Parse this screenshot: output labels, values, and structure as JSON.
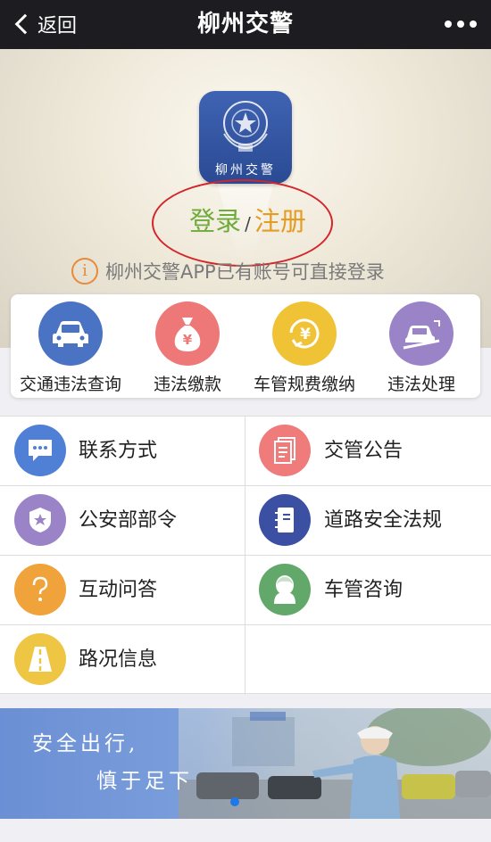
{
  "nav": {
    "back_label": "返回",
    "title": "柳州交警"
  },
  "hero": {
    "logo_text": "柳州交警",
    "login_label": "登录",
    "slash": "/",
    "register_label": "注册",
    "notice_icon_char": "i",
    "notice_text": "柳州交警APP已有账号可直接登录"
  },
  "services": [
    {
      "label": "交通违法查询",
      "icon": "car-icon",
      "color": "#4a74c3"
    },
    {
      "label": "违法缴款",
      "icon": "money-bag-icon",
      "color": "#ee7878"
    },
    {
      "label": "车管规费缴纳",
      "icon": "yen-refresh-icon",
      "color": "#f0c235"
    },
    {
      "label": "违法处理",
      "icon": "car-slope-icon",
      "color": "#9b83c7"
    }
  ],
  "menu": [
    {
      "label": "联系方式",
      "icon": "chat-bubble-icon",
      "color": "#4f80d6"
    },
    {
      "label": "交管公告",
      "icon": "document-icon",
      "color": "#ef7b7b"
    },
    {
      "label": "公安部部令",
      "icon": "police-badge-icon",
      "color": "#9b83c7"
    },
    {
      "label": "道路安全法规",
      "icon": "notebook-icon",
      "color": "#3b4fa3"
    },
    {
      "label": "互动问答",
      "icon": "question-icon",
      "color": "#f0a33a"
    },
    {
      "label": "车管咨询",
      "icon": "person-icon",
      "color": "#62a86a"
    },
    {
      "label": "路况信息",
      "icon": "road-icon",
      "color": "#efc544"
    }
  ],
  "banner": {
    "line1": "安全出行,",
    "line2": "慎于足下"
  }
}
